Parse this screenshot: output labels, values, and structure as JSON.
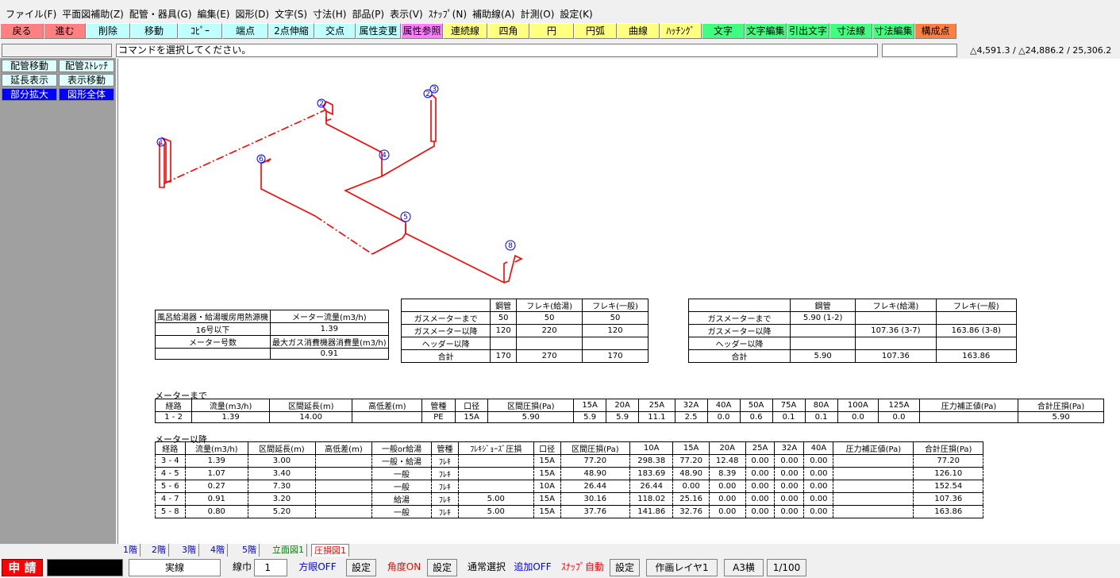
{
  "menu": [
    "ファイル(F)",
    "平面図補助(Z)",
    "配管・器具(G)",
    "編集(E)",
    "図形(D)",
    "文字(S)",
    "寸法(H)",
    "部品(P)",
    "表示(V)",
    "ｽﾅｯﾌﾟ(N)",
    "補助線(A)",
    "計測(O)",
    "設定(K)"
  ],
  "toolbar": [
    {
      "label": "戻る",
      "color": "#ff8080"
    },
    {
      "label": "進む",
      "color": "#ff8080"
    },
    {
      "label": "削除",
      "color": "#c0ffff"
    },
    {
      "label": "移動",
      "color": "#c0ffff"
    },
    {
      "label": "ｺﾋﾟｰ",
      "color": "#c0ffff"
    },
    {
      "label": "端点",
      "color": "#c0ffff"
    },
    {
      "label": "2点伸縮",
      "color": "#c0ffff"
    },
    {
      "label": "交点",
      "color": "#c0ffff"
    },
    {
      "label": "属性変更",
      "color": "#c0ffff"
    },
    {
      "label": "属性参照",
      "color": "#ff80ff"
    },
    {
      "label": "連続線",
      "color": "#ffff80"
    },
    {
      "label": "四角",
      "color": "#ffff80"
    },
    {
      "label": "円",
      "color": "#ffff80"
    },
    {
      "label": "円弧",
      "color": "#ffff80"
    },
    {
      "label": "曲線",
      "color": "#ffff80"
    },
    {
      "label": "ﾊｯﾁﾝｸﾞ",
      "color": "#ffff80"
    },
    {
      "label": "文字",
      "color": "#40ff80"
    },
    {
      "label": "文字編集",
      "color": "#40ff80"
    },
    {
      "label": "引出文字",
      "color": "#40ff80"
    },
    {
      "label": "寸法線",
      "color": "#40ff80"
    },
    {
      "label": "寸法編集",
      "color": "#40ff80"
    },
    {
      "label": "構成点",
      "color": "#ff8040"
    }
  ],
  "command_message": "コマンドを選択してください。",
  "coords": "△4,591.3 / △24,886.2 / 25,306.2",
  "side_buttons": [
    {
      "label": "配管移動",
      "style": "cyan"
    },
    {
      "label": "配管ｽﾄﾚｯﾁ",
      "style": "cyan"
    },
    {
      "label": "延長表示",
      "style": "cyan"
    },
    {
      "label": "表示移動",
      "style": "cyan"
    },
    {
      "label": "部分拡大",
      "style": "blue"
    },
    {
      "label": "図形全体",
      "style": "blue"
    }
  ],
  "drawing": {
    "markers": [
      "1",
      "2",
      "3",
      "4",
      "5",
      "6",
      "8"
    ],
    "pipe_color": "#ff0000",
    "marker_color": "#0000ff"
  },
  "table1": {
    "rows": [
      [
        "風呂給湯器・給湯暖房用熱源機",
        "メーター流量(m3/h)"
      ],
      [
        "16号以下",
        "1.39"
      ],
      [
        "メーター号数",
        "最大ガス消費機器消費量(m3/h)"
      ],
      [
        "",
        "0.91"
      ]
    ]
  },
  "table2": {
    "header": [
      "",
      "鋼管",
      "フレキ(給湯)",
      "フレキ(一般)"
    ],
    "rows": [
      [
        "ガスメーターまで",
        "50",
        "50",
        "50"
      ],
      [
        "ガスメーター以降",
        "120",
        "220",
        "120"
      ],
      [
        "ヘッダー以降",
        "",
        "",
        ""
      ],
      [
        "合計",
        "170",
        "270",
        "170"
      ]
    ]
  },
  "table3": {
    "header": [
      "",
      "鋼管",
      "フレキ(給湯)",
      "フレキ(一般)"
    ],
    "rows": [
      [
        "ガスメーターまで",
        "5.90 (1-2)",
        "",
        ""
      ],
      [
        "ガスメーター以降",
        "",
        "107.36 (3-7)",
        "163.86 (3-8)"
      ],
      [
        "ヘッダー以降",
        "",
        "",
        ""
      ],
      [
        "合計",
        "5.90",
        "107.36",
        "163.86"
      ]
    ]
  },
  "meter_before": {
    "title": "メーターまで",
    "header": [
      "経路",
      "流量(m3/h)",
      "区間延長(m)",
      "高低差(m)",
      "管種",
      "口径",
      "区間圧損(Pa)",
      "15A",
      "20A",
      "25A",
      "32A",
      "40A",
      "50A",
      "75A",
      "80A",
      "100A",
      "125A",
      "圧力補正値(Pa)",
      "合計圧損(Pa)"
    ],
    "rows": [
      [
        "1 - 2",
        "1.39",
        "14.00",
        "",
        "PE",
        "15A",
        "5.90",
        "5.9",
        "5.9",
        "11.1",
        "2.5",
        "0.0",
        "0.6",
        "0.1",
        "0.1",
        "0.0",
        "0.0",
        "",
        "5.90"
      ]
    ]
  },
  "meter_after": {
    "title": "メーター以降",
    "header": [
      "経路",
      "流量(m3/h)",
      "区間延長(m)",
      "高低差(m)",
      "一般or給湯",
      "管種",
      "ﾌﾚｷｼﾞｮｰｽﾞ圧損",
      "口径",
      "区間圧損(Pa)",
      "10A",
      "15A",
      "20A",
      "25A",
      "32A",
      "40A",
      "圧力補正値(Pa)",
      "合計圧損(Pa)"
    ],
    "rows": [
      [
        "3 - 4",
        "1.39",
        "3.00",
        "",
        "一般・給湯",
        "ﾌﾚｷ",
        "",
        "15A",
        "77.20",
        "298.38",
        "77.20",
        "12.48",
        "0.00",
        "0.00",
        "0.00",
        "",
        "77.20"
      ],
      [
        "4 - 5",
        "1.07",
        "3.40",
        "",
        "一般",
        "ﾌﾚｷ",
        "",
        "15A",
        "48.90",
        "183.69",
        "48.90",
        "8.39",
        "0.00",
        "0.00",
        "0.00",
        "",
        "126.10"
      ],
      [
        "5 - 6",
        "0.27",
        "7.30",
        "",
        "一般",
        "ﾌﾚｷ",
        "",
        "10A",
        "26.44",
        "26.44",
        "0.00",
        "0.00",
        "0.00",
        "0.00",
        "0.00",
        "",
        "152.54"
      ],
      [
        "4 - 7",
        "0.91",
        "3.20",
        "",
        "給湯",
        "ﾌﾚｷ",
        "5.00",
        "15A",
        "30.16",
        "118.02",
        "25.16",
        "0.00",
        "0.00",
        "0.00",
        "0.00",
        "",
        "107.36"
      ],
      [
        "5 - 8",
        "0.80",
        "5.20",
        "",
        "一般",
        "ﾌﾚｷ",
        "5.00",
        "15A",
        "37.76",
        "141.86",
        "32.76",
        "0.00",
        "0.00",
        "0.00",
        "0.00",
        "",
        "163.86"
      ]
    ]
  },
  "tabs": [
    {
      "label": "1階",
      "active": false
    },
    {
      "label": "2階",
      "active": false
    },
    {
      "label": "3階",
      "active": false
    },
    {
      "label": "4階",
      "active": false
    },
    {
      "label": "5階",
      "active": false
    },
    {
      "label": "立面図1",
      "active": false,
      "green": true
    },
    {
      "label": "圧損図1",
      "active": true
    }
  ],
  "status": {
    "mode": "申 請",
    "line_type": "実線",
    "line_width_label": "線巾",
    "line_width_value": "1",
    "grid": "方眼OFF",
    "grid_setting": "設定",
    "angle": "角度ON",
    "angle_setting": "設定",
    "select_mode": "通常選択",
    "add_mode": "追加OFF",
    "snap": "ｽﾅｯﾌﾟ自動",
    "snap_setting": "設定",
    "layer": "作画レイヤ1",
    "paper": "A3横",
    "scale": "1/100"
  }
}
